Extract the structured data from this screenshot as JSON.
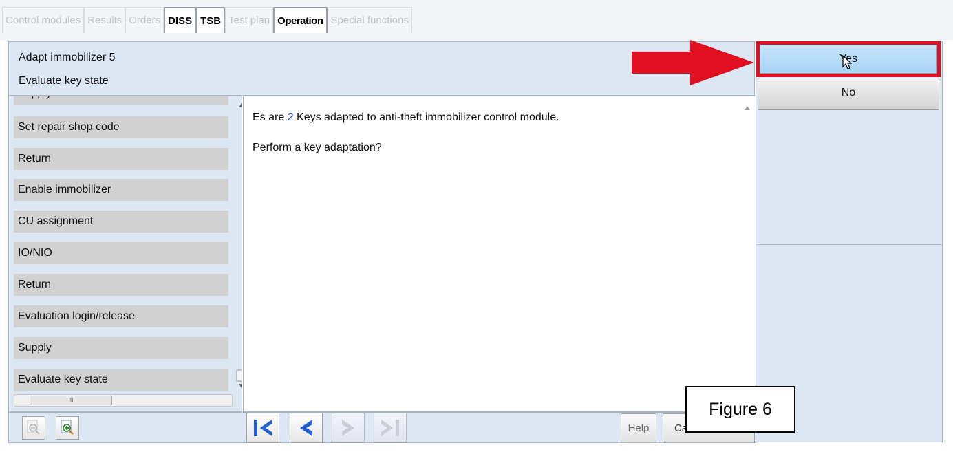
{
  "tabs": [
    {
      "label": "Control modules",
      "state": "disabled"
    },
    {
      "label": "Results",
      "state": "disabled"
    },
    {
      "label": "Orders",
      "state": "disabled"
    },
    {
      "label": "DISS",
      "state": "enabled"
    },
    {
      "label": "TSB",
      "state": "enabled"
    },
    {
      "label": "Test plan",
      "state": "disabled"
    },
    {
      "label": "Operation",
      "state": "active"
    },
    {
      "label": "Special functions",
      "state": "disabled"
    }
  ],
  "header": {
    "title": "Adapt immobilizer 5",
    "subtitle": "Evaluate key state"
  },
  "sidebar": {
    "items": [
      {
        "label": "Supply"
      },
      {
        "label": "Set repair shop code"
      },
      {
        "label": "Return"
      },
      {
        "label": "Enable immobilizer"
      },
      {
        "label": "CU assignment"
      },
      {
        "label": "IO/NIO"
      },
      {
        "label": "Return"
      },
      {
        "label": "Evaluation login/release"
      },
      {
        "label": "Supply"
      },
      {
        "label": "Evaluate key state"
      }
    ],
    "hscroll_thumb_text": "III"
  },
  "message": {
    "line1_prefix": "Es are ",
    "key_count": "2",
    "line1_suffix": " Keys adapted to anti-theft immobilizer control module.",
    "line2": "Perform a key adaptation?"
  },
  "dialog": {
    "yes_label": "Yes",
    "no_label": "No"
  },
  "toolbar": {
    "zoom_out_icon": "zoom-out-icon",
    "zoom_in_icon": "zoom-in-icon",
    "first_icon": "first-page-icon",
    "back_icon": "back-icon",
    "forward_icon": "forward-icon",
    "last_icon": "last-page-icon",
    "help_label": "Help",
    "cancel_label": "Cancel test"
  },
  "figure_label": "Figure 6",
  "colors": {
    "panel_bg": "#dde6f3",
    "highlight_red": "#e01020",
    "nav_blue": "#1f5fd0",
    "key_count_blue": "#1f3fe0"
  }
}
